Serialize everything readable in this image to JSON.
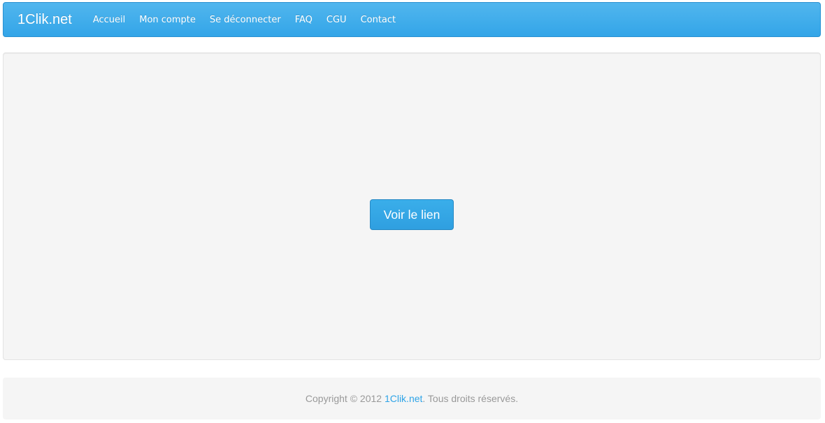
{
  "navbar": {
    "brand": "1Clik.net",
    "items": [
      {
        "label": "Accueil"
      },
      {
        "label": "Mon compte"
      },
      {
        "label": "Se déconnecter"
      },
      {
        "label": "FAQ"
      },
      {
        "label": "CGU"
      },
      {
        "label": "Contact"
      }
    ],
    "color": "#33a5e8"
  },
  "main": {
    "button_label": "Voir le lien"
  },
  "footer": {
    "prefix": "Copyright © 2012",
    "link": "1Clik.net",
    "suffix": ". Tous droits réservés."
  }
}
